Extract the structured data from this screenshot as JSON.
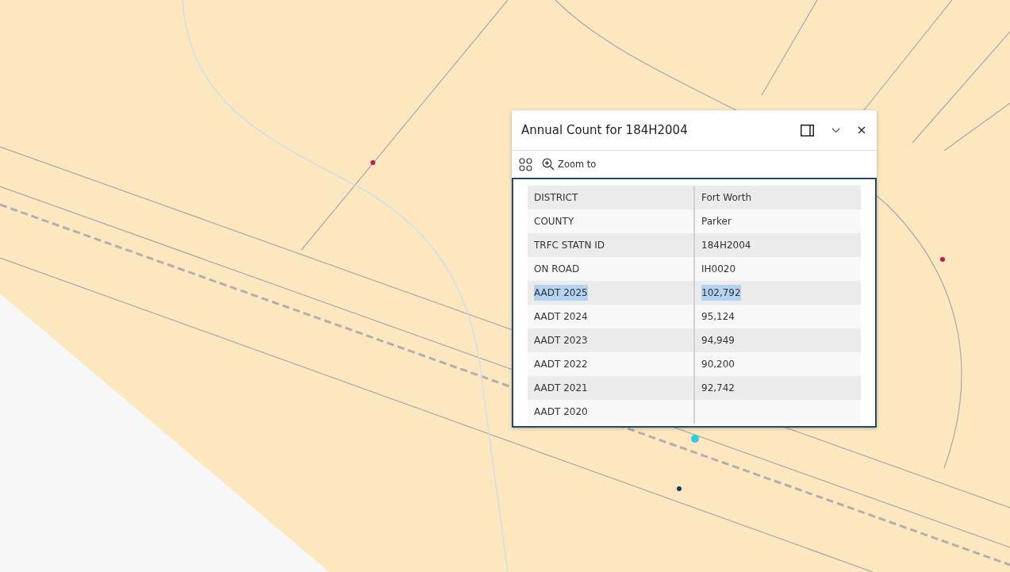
{
  "popup": {
    "title": "Annual Count for 184H2004",
    "toolbar": {
      "zoom_label": "Zoom to"
    },
    "rows": [
      {
        "field": "DISTRICT",
        "value": "Fort Worth",
        "selected": false
      },
      {
        "field": "COUNTY",
        "value": "Parker",
        "selected": false
      },
      {
        "field": "TRFC STATN ID",
        "value": "184H2004",
        "selected": false
      },
      {
        "field": "ON ROAD",
        "value": "IH0020",
        "selected": false
      },
      {
        "field": "AADT 2025",
        "value": "102,792",
        "selected": true
      },
      {
        "field": "AADT 2024",
        "value": "95,124",
        "selected": false
      },
      {
        "field": "AADT 2023",
        "value": "94,949",
        "selected": false
      },
      {
        "field": "AADT 2022",
        "value": "90,200",
        "selected": false
      },
      {
        "field": "AADT 2021",
        "value": "92,742",
        "selected": false
      },
      {
        "field": "AADT 2020",
        "selected": false
      }
    ]
  }
}
